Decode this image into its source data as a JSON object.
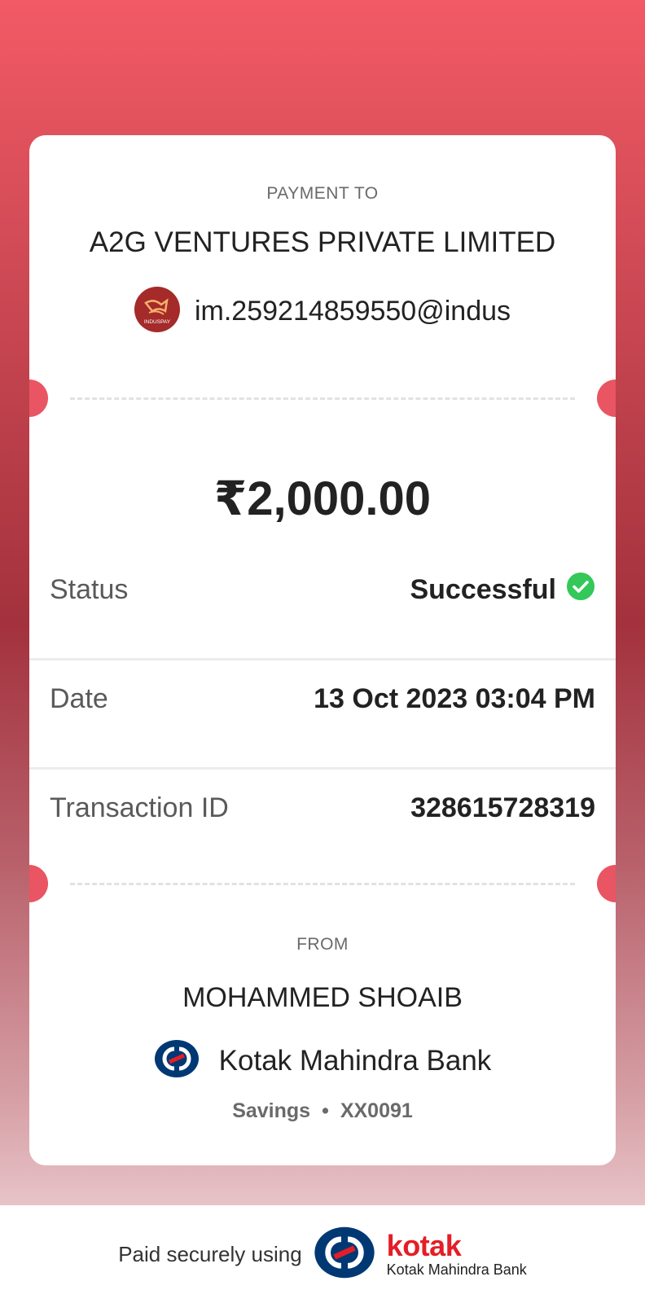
{
  "payment": {
    "to_label": "PAYMENT TO",
    "payee_name": "A2G VENTURES PRIVATE LIMITED",
    "payee_vpa": "im.259214859550@indus",
    "payee_logo_text": "INDUSPAY",
    "amount": "₹2,000.00"
  },
  "details": {
    "status_label": "Status",
    "status_value": "Successful",
    "date_label": "Date",
    "date_value": "13 Oct 2023 03:04 PM",
    "txn_label": "Transaction ID",
    "txn_value": "328615728319"
  },
  "from": {
    "label": "FROM",
    "name": "MOHAMMED SHOAIB",
    "bank": "Kotak Mahindra Bank",
    "account_type": "Savings",
    "separator": "•",
    "account_number": "XX0091"
  },
  "footer": {
    "text": "Paid securely using",
    "brand": "kotak",
    "brand_sub": "Kotak Mahindra Bank"
  },
  "icons": {
    "status": "check-circle-icon",
    "payee": "induspay-logo-icon",
    "bank": "kotak-logo-icon"
  },
  "colors": {
    "success": "#34c759",
    "kotak_red": "#e41e26",
    "kotak_blue": "#003874",
    "notch": "#e95562"
  }
}
